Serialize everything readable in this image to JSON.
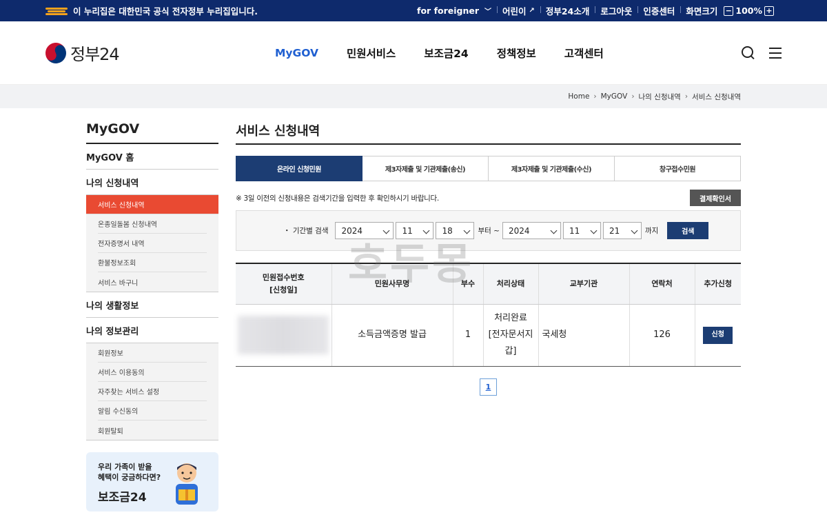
{
  "gov_bar": {
    "notice": "이 누리집은 대한민국 공식 전자정부 누리집입니다.",
    "links": [
      "for foreigner",
      "어린이",
      "정부24소개",
      "로그아웃",
      "인증센터"
    ],
    "zoom_label": "화면크기",
    "zoom_minus": "−",
    "zoom_value": "100%",
    "zoom_plus": "+"
  },
  "header": {
    "logo_text": "정부24",
    "nav": [
      "MyGOV",
      "민원서비스",
      "보조금24",
      "정책정보",
      "고객센터"
    ]
  },
  "breadcrumb": [
    "Home",
    "MyGOV",
    "나의 신청내역",
    "서비스 신청내역"
  ],
  "sidebar": {
    "title": "MyGOV",
    "home": "MyGOV 홈",
    "section1": "나의 신청내역",
    "section1_items": [
      "서비스 신청내역",
      "온종일돌봄 신청내역",
      "전자증명서 내역",
      "환불정보조회",
      "서비스 바구니"
    ],
    "section2": "나의 생활정보",
    "section3": "나의 정보관리",
    "section3_items": [
      "회원정보",
      "서비스 이용동의",
      "자주찾는 서비스 설정",
      "알림 수신동의",
      "회원탈퇴"
    ],
    "promo_line1": "우리 가족이 받을",
    "promo_line2": "혜택이 궁금하다면?",
    "promo_title": "보조금24"
  },
  "main": {
    "title": "서비스 신청내역",
    "tabs": [
      "온라인 신청민원",
      "제3자제출 및 기관제출(송신)",
      "제3자제출 및 기관제출(수신)",
      "창구접수민원"
    ],
    "notice": "※ 3일 이전의 신청내용은 검색기간을 입력한 후 확인하시기 바랍니다.",
    "payment_button": "결제확인서",
    "search": {
      "label": "・ 기간별 검색",
      "from_year": "2024",
      "from_month": "11",
      "from_day": "18",
      "from_suffix": "부터 ~",
      "to_year": "2024",
      "to_month": "11",
      "to_day": "21",
      "to_suffix": "까지",
      "button": "검색"
    },
    "watermark": "호두몽",
    "table": {
      "headers": [
        "민원접수번호\n[신청일]",
        "민원사무명",
        "부수",
        "처리상태",
        "교부기관",
        "연락처",
        "추가신청"
      ],
      "rows": [
        {
          "service": "소득금액증명 발급",
          "copies": "1",
          "status": "처리완료\n[전자문서지갑]",
          "agency": "국세청",
          "contact": "126",
          "action": "신청"
        }
      ]
    },
    "pages": [
      "1"
    ]
  }
}
